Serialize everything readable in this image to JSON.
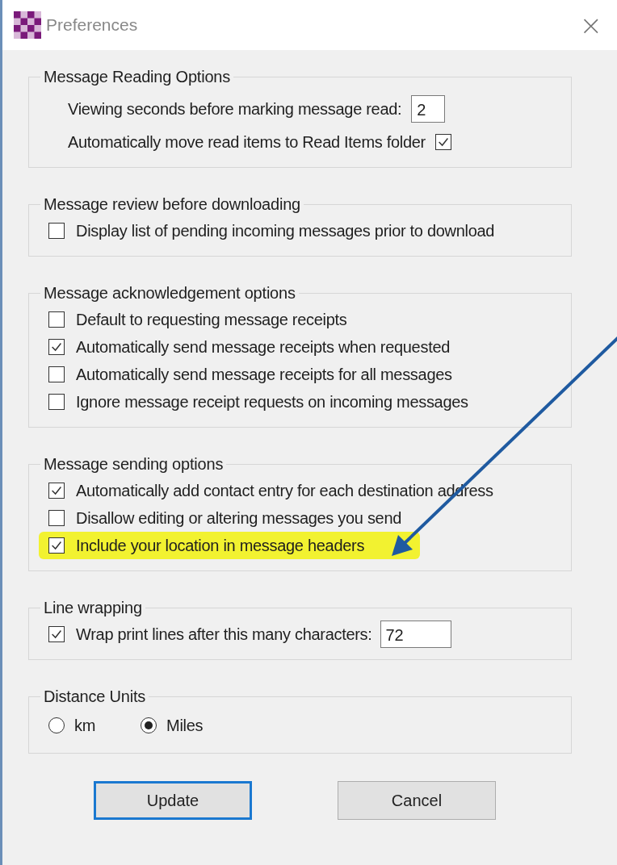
{
  "window": {
    "title": "Preferences",
    "close": "×"
  },
  "groups": [
    {
      "title": "Message Reading Options",
      "rows": [
        {
          "kind": "field",
          "label": "Viewing seconds before marking message read:",
          "value": "2"
        },
        {
          "kind": "check-right",
          "label": "Automatically move read items to Read Items folder",
          "checked": true
        }
      ]
    },
    {
      "title": "Message review before downloading",
      "rows": [
        {
          "kind": "check",
          "label": "Display list of pending incoming messages prior to download",
          "checked": false,
          "highlighted": false
        }
      ]
    },
    {
      "title": "Message acknowledgement options",
      "rows": [
        {
          "kind": "check",
          "label": "Default to requesting message receipts",
          "checked": false,
          "highlighted": false
        },
        {
          "kind": "check",
          "label": "Automatically send message receipts when requested",
          "checked": true,
          "highlighted": false
        },
        {
          "kind": "check",
          "label": "Automatically send message receipts for all messages",
          "checked": false,
          "highlighted": false
        },
        {
          "kind": "check",
          "label": "Ignore message receipt requests on incoming messages",
          "checked": false,
          "highlighted": false
        }
      ]
    },
    {
      "title": "Message sending options",
      "rows": [
        {
          "kind": "check",
          "label": "Automatically add contact entry for each destination address",
          "checked": true,
          "highlighted": false
        },
        {
          "kind": "check",
          "label": "Disallow editing or altering messages you send",
          "checked": false,
          "highlighted": false
        },
        {
          "kind": "check",
          "label": "Include your location in message headers",
          "checked": true,
          "highlighted": true
        }
      ]
    },
    {
      "title": "Line wrapping",
      "rows": [
        {
          "kind": "check-field",
          "label": "Wrap print lines after this many characters:",
          "checked": true,
          "highlighted": false,
          "value": "72"
        }
      ]
    },
    {
      "title": "Distance Units",
      "rows": [
        {
          "kind": "radios",
          "options": [
            {
              "label": "km",
              "selected": false
            },
            {
              "label": "Miles",
              "selected": true
            }
          ]
        }
      ]
    }
  ],
  "buttons": [
    {
      "label": "Update",
      "default": true
    },
    {
      "label": "Cancel",
      "default": false
    }
  ]
}
